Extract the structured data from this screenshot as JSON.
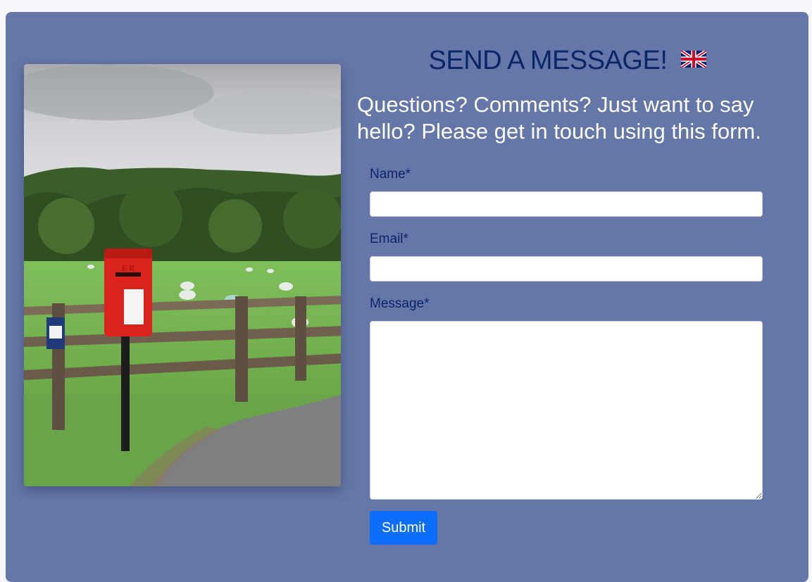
{
  "form": {
    "heading": "SEND A MESSAGE!",
    "heading_icon": "uk-flag-icon",
    "intro": "Questions? Comments? Just want to say hello? Please get in touch using this form.",
    "fields": {
      "name": {
        "label": "Name*",
        "value": ""
      },
      "email": {
        "label": "Email*",
        "value": ""
      },
      "message": {
        "label": "Message*",
        "value": ""
      }
    },
    "submit_label": "Submit"
  },
  "photo": {
    "subject": "red postbox by a wooden fence in a sheep pasture",
    "postbox_text": "E R"
  },
  "colors": {
    "page_bg": "#f6f8fb",
    "card_bg": "#6577a8",
    "heading": "#0b2567",
    "intro_text": "#ffffff",
    "button": "#0d6efd"
  }
}
